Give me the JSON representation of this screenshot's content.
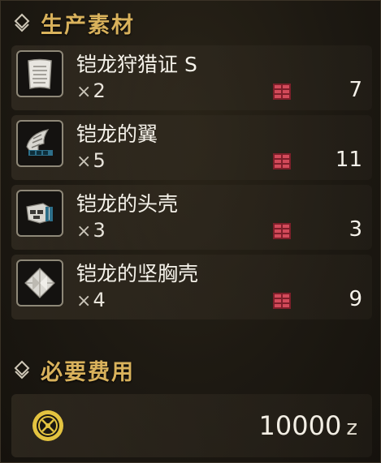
{
  "sections": {
    "materials_title": "生产素材",
    "cost_title": "必要费用"
  },
  "materials": [
    {
      "name": "铠龙狩猎证 S",
      "qty_prefix": "×",
      "qty": "2",
      "owned": "7",
      "icon": "hunter-ticket-icon"
    },
    {
      "name": "铠龙的翼",
      "qty_prefix": "×",
      "qty": "5",
      "owned": "11",
      "icon": "wing-icon"
    },
    {
      "name": "铠龙的头壳",
      "qty_prefix": "×",
      "qty": "3",
      "owned": "3",
      "icon": "head-shell-icon"
    },
    {
      "name": "铠龙的坚胸壳",
      "qty_prefix": "×",
      "qty": "4",
      "owned": "9",
      "icon": "chest-shell-icon"
    }
  ],
  "cost": {
    "value": "10000",
    "unit": "z",
    "icon": "zenny-coin-icon"
  },
  "colors": {
    "header_gold": "#d9b25c",
    "box_red": "#c0394a",
    "coin_gold": "#e3c340"
  }
}
